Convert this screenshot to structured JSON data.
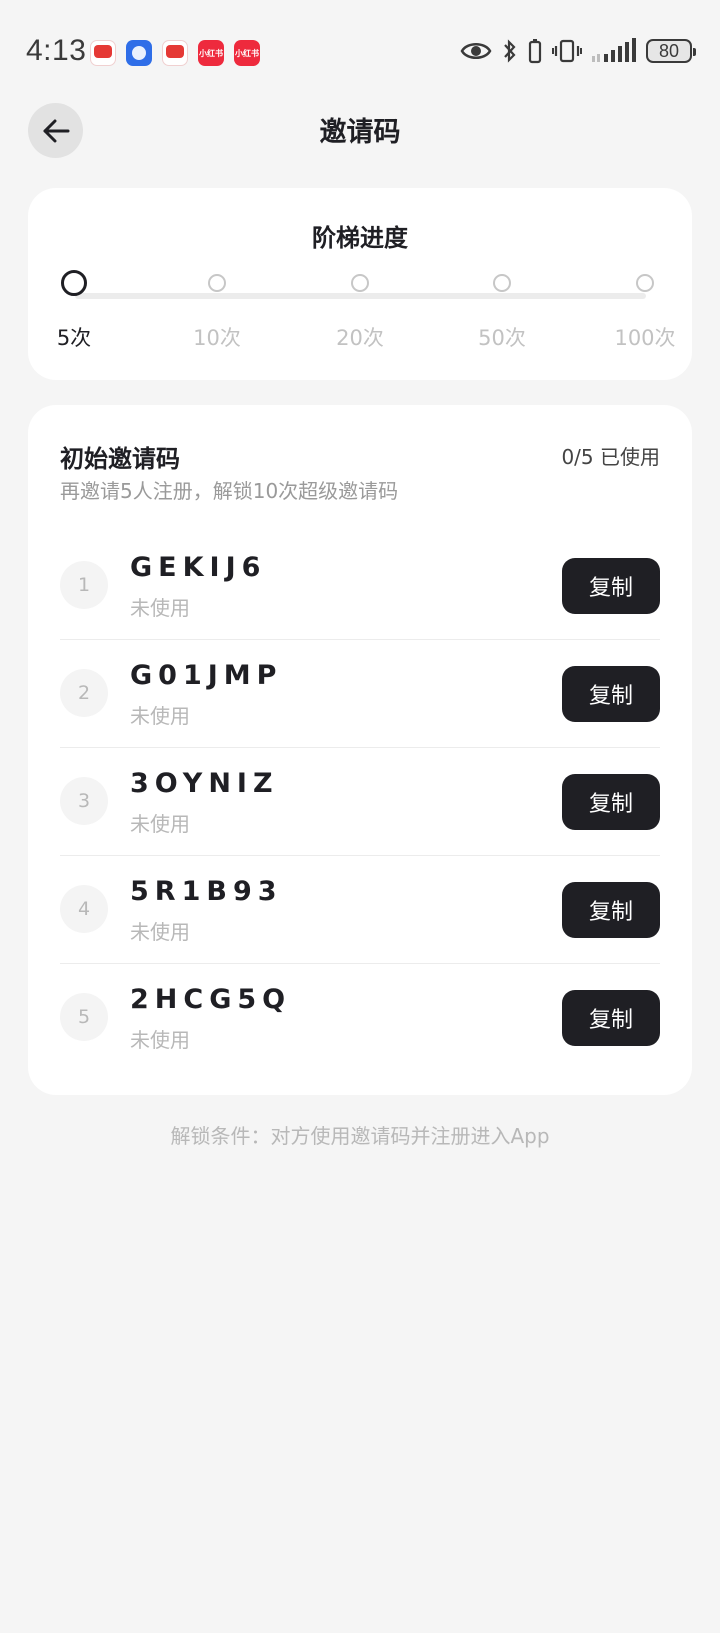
{
  "status_bar": {
    "time": "4:13",
    "battery": "80",
    "notification_icons": [
      "red-app-icon",
      "blue-app-icon",
      "red-app-icon",
      "xiaohongshu-icon",
      "xiaohongshu-icon"
    ],
    "xhs_label": "小红书"
  },
  "header": {
    "title": "邀请码"
  },
  "progress": {
    "title": "阶梯进度",
    "current_milestone": "5次",
    "milestones": [
      {
        "label": "5次",
        "active": true
      },
      {
        "label": "10次",
        "active": false
      },
      {
        "label": "20次",
        "active": false
      },
      {
        "label": "50次",
        "active": false
      },
      {
        "label": "100次",
        "active": false
      }
    ]
  },
  "codes": {
    "title": "初始邀请码",
    "usage": "0/5 已使用",
    "subtitle": "再邀请5人注册，解锁10次超级邀请码",
    "copy_label": "复制",
    "items": [
      {
        "index": "1",
        "code": "GEKIJ6",
        "status": "未使用"
      },
      {
        "index": "2",
        "code": "G01JMP",
        "status": "未使用"
      },
      {
        "index": "3",
        "code": "3OYNIZ",
        "status": "未使用"
      },
      {
        "index": "4",
        "code": "5R1B93",
        "status": "未使用"
      },
      {
        "index": "5",
        "code": "2HCG5Q",
        "status": "未使用"
      }
    ]
  },
  "footer": {
    "note": "解锁条件：对方使用邀请码并注册进入App"
  },
  "colors": {
    "background": "#f5f5f5",
    "card": "#ffffff",
    "primary_dark": "#1f1f24",
    "muted_text": "#b8b8b8"
  }
}
